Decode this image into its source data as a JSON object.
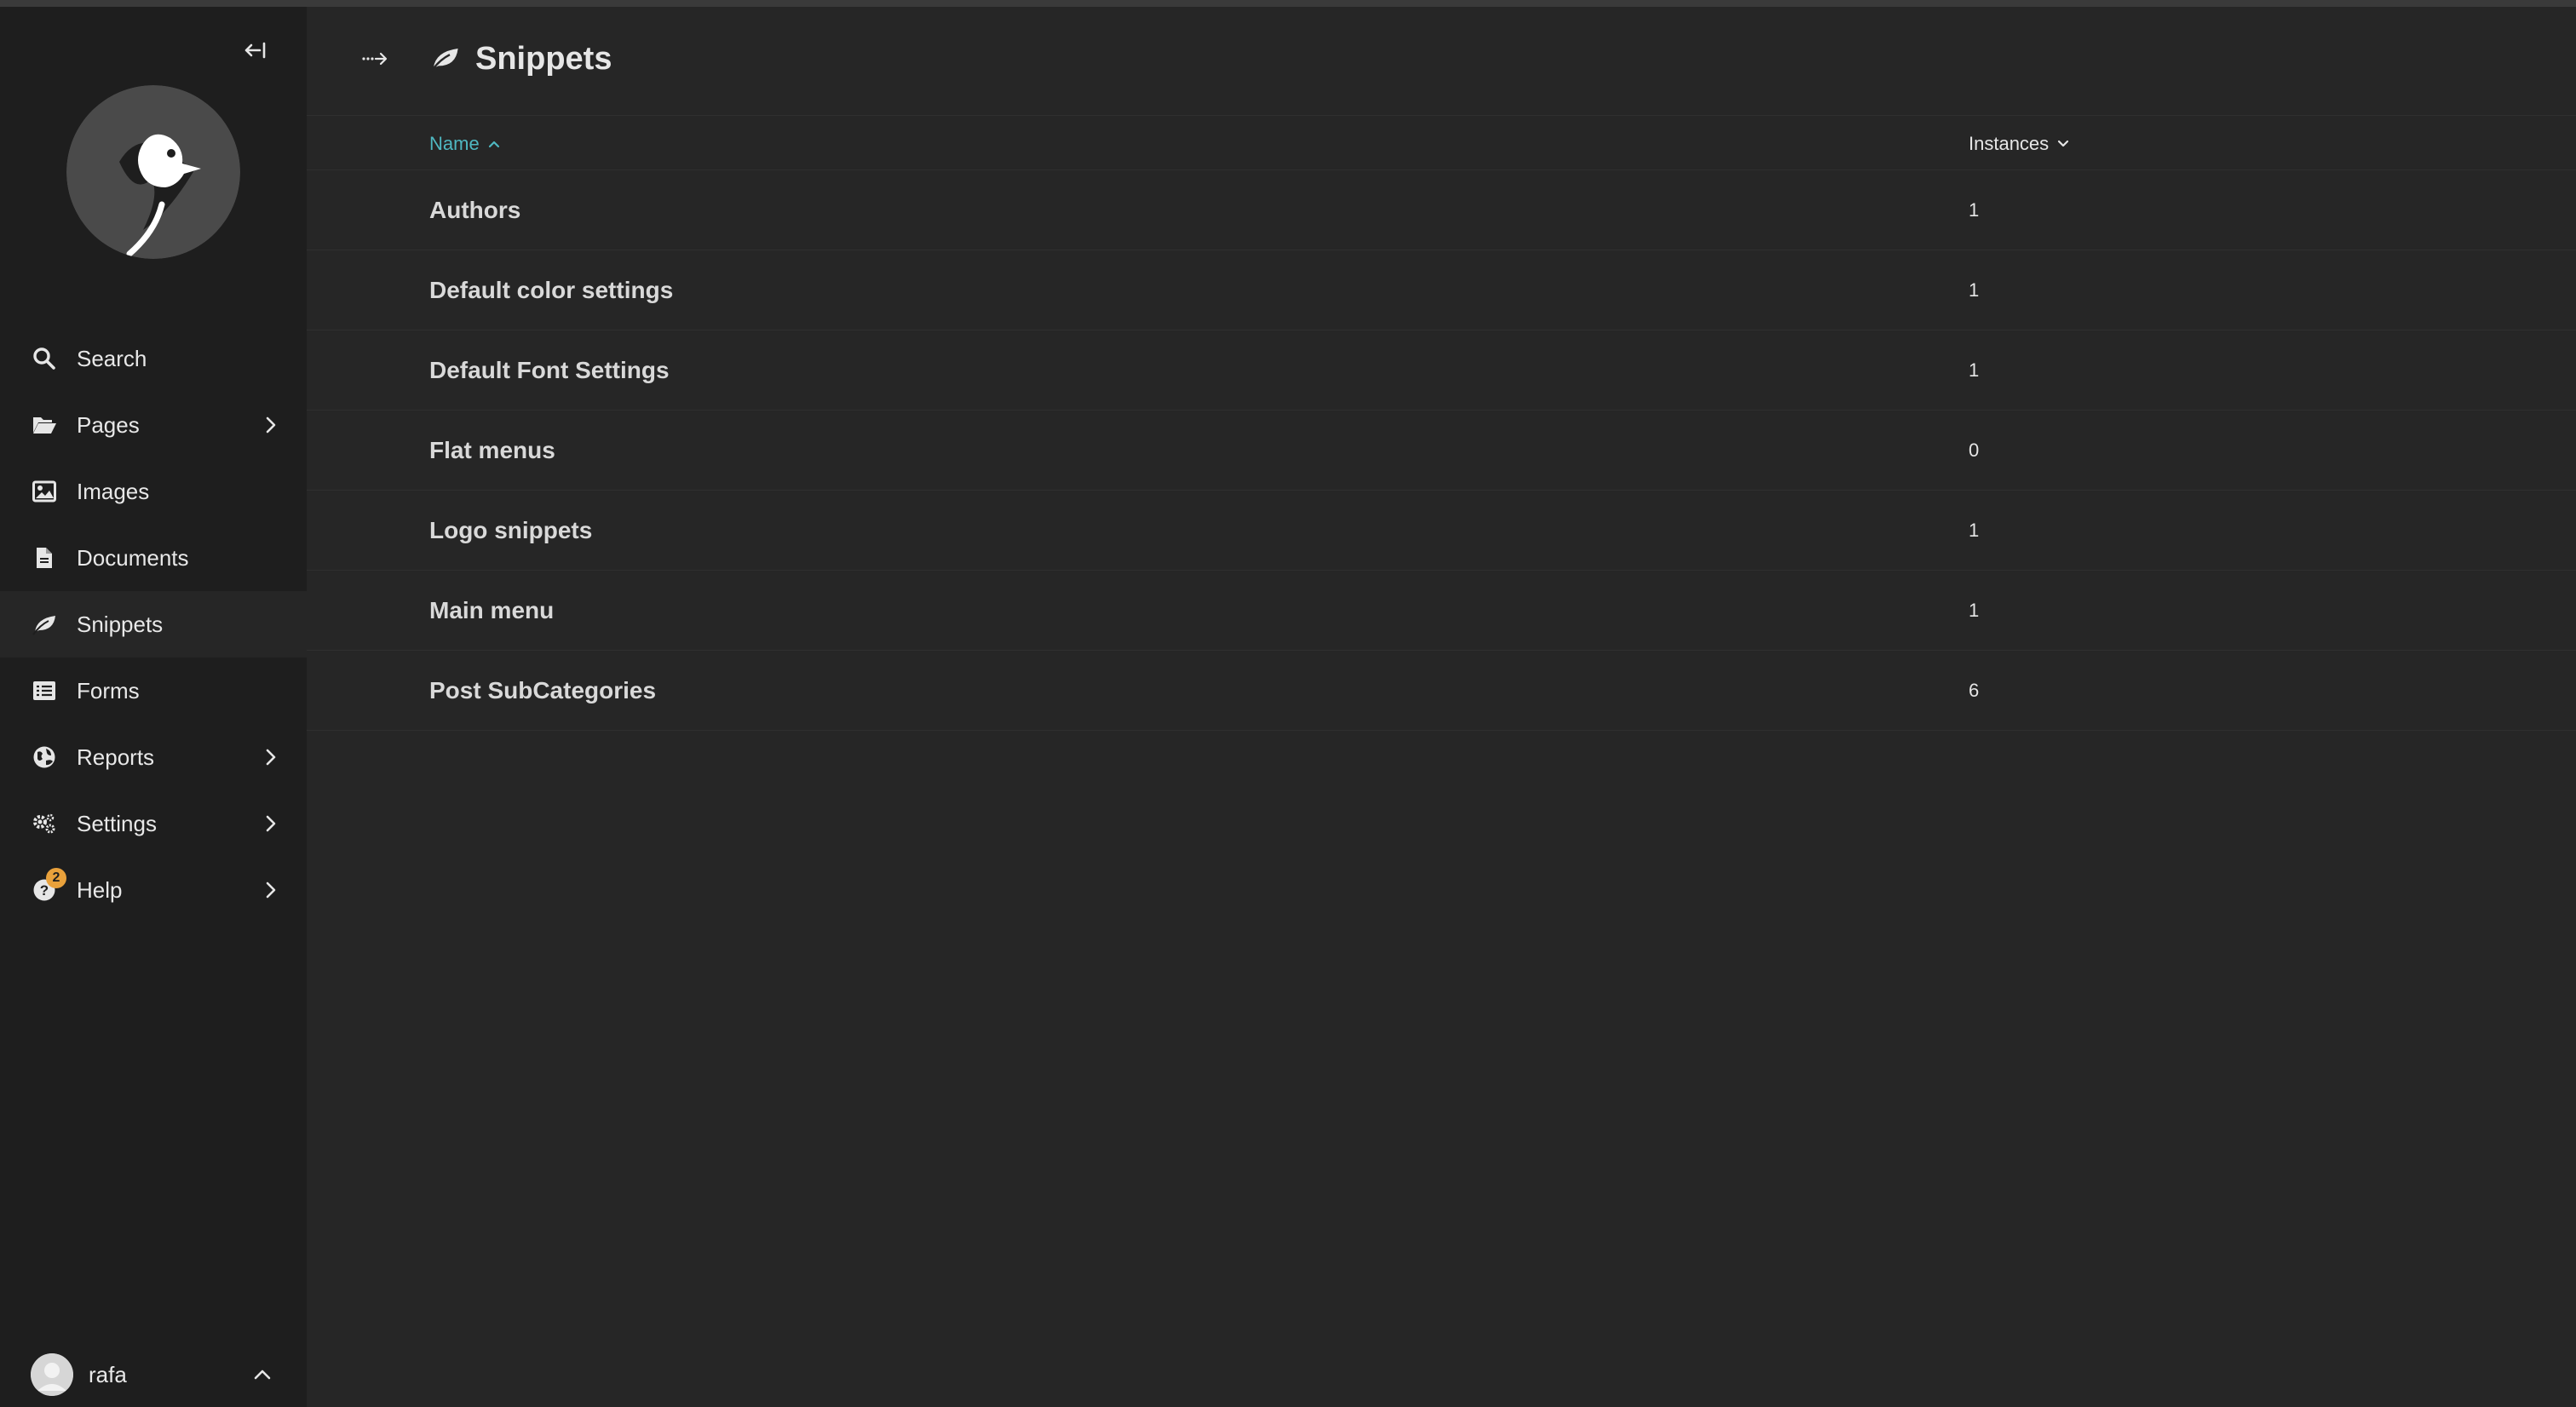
{
  "sidebar": {
    "items": [
      {
        "label": "Search",
        "icon": "search-icon",
        "has_submenu": false,
        "active": false
      },
      {
        "label": "Pages",
        "icon": "folder-open-icon",
        "has_submenu": true,
        "active": false
      },
      {
        "label": "Images",
        "icon": "image-icon",
        "has_submenu": false,
        "active": false
      },
      {
        "label": "Documents",
        "icon": "document-icon",
        "has_submenu": false,
        "active": false
      },
      {
        "label": "Snippets",
        "icon": "snippet-icon",
        "has_submenu": false,
        "active": true
      },
      {
        "label": "Forms",
        "icon": "list-icon",
        "has_submenu": false,
        "active": false
      },
      {
        "label": "Reports",
        "icon": "globe-icon",
        "has_submenu": true,
        "active": false
      },
      {
        "label": "Settings",
        "icon": "cogs-icon",
        "has_submenu": true,
        "active": false
      },
      {
        "label": "Help",
        "icon": "help-icon",
        "has_submenu": true,
        "active": false,
        "badge": "2"
      }
    ],
    "account": {
      "username": "rafa"
    }
  },
  "header": {
    "title": "Snippets"
  },
  "table": {
    "columns": {
      "name": "Name",
      "instances": "Instances"
    },
    "rows": [
      {
        "name": "Authors",
        "instances": "1"
      },
      {
        "name": "Default color settings",
        "instances": "1"
      },
      {
        "name": "Default Font Settings",
        "instances": "1"
      },
      {
        "name": "Flat menus",
        "instances": "0"
      },
      {
        "name": "Logo snippets",
        "instances": "1"
      },
      {
        "name": "Main menu",
        "instances": "1"
      },
      {
        "name": "Post SubCategories",
        "instances": "6"
      }
    ]
  },
  "colors": {
    "sidebar_bg": "#1e1e1e",
    "main_bg": "#262626",
    "accent": "#4fb8c1",
    "badge": "#e9a13b"
  }
}
